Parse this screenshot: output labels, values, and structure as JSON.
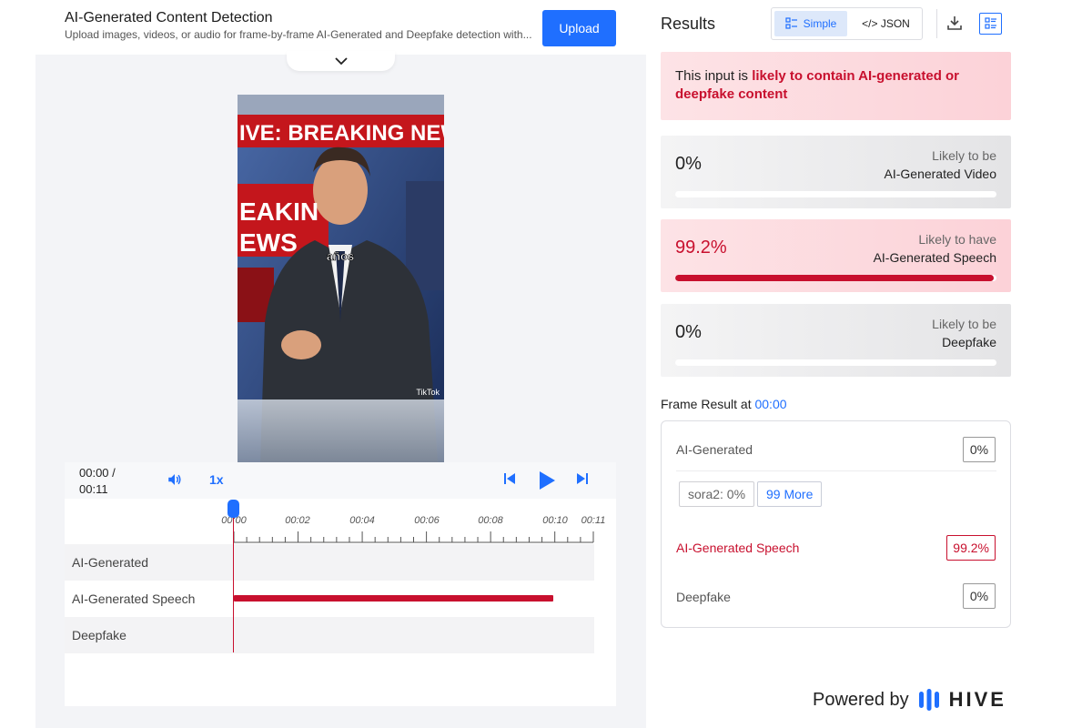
{
  "header": {
    "title": "AI-Generated Content Detection",
    "subtitle": "Upload images, videos, or audio for frame-by-frame AI-Generated and Deepfake detection with...",
    "upload_label": "Upload"
  },
  "video": {
    "banner_text": "IVE: BREAKING NEW",
    "side_text_1": "EAKIN",
    "side_text_2": "EWS",
    "caption": "años",
    "watermark": "TikTok"
  },
  "player": {
    "time_current": "00:00 /",
    "time_total": "00:11",
    "speed": "1x",
    "timeline_labels": [
      "00:00",
      "00:02",
      "00:04",
      "00:06",
      "00:08",
      "00:10",
      "00:11"
    ],
    "tracks": [
      "AI-Generated",
      "AI-Generated Speech",
      "Deepfake"
    ]
  },
  "results": {
    "title": "Results",
    "view_simple": "Simple",
    "view_json": "</> JSON",
    "verdict_prefix": "This input is ",
    "verdict_highlight": "likely to contain AI-generated or deepfake content",
    "cards": [
      {
        "pct": "0%",
        "line1": "Likely to be",
        "line2": "AI-Generated Video",
        "fill": 0
      },
      {
        "pct": "99.2%",
        "line1": "Likely to have",
        "line2": "AI-Generated Speech",
        "fill": 0.992
      },
      {
        "pct": "0%",
        "line1": "Likely to be",
        "line2": "Deepfake",
        "fill": 0
      }
    ]
  },
  "frame": {
    "label": "Frame Result at ",
    "time": "00:00",
    "rows": {
      "ai_label": "AI-Generated",
      "ai_value": "0%",
      "chip_model": "sora2: 0%",
      "chip_more": "99 More",
      "speech_label": "AI-Generated Speech",
      "speech_value": "99.2%",
      "deepfake_label": "Deepfake",
      "deepfake_value": "0%"
    }
  },
  "footer": {
    "powered_by": "Powered by",
    "brand": "HIVE"
  },
  "colors": {
    "accent": "#1f6fff",
    "alert": "#c8102e"
  },
  "icons": {
    "collapse": "chevron-down-icon",
    "volume": "volume-icon",
    "prev": "skip-back-icon",
    "play": "play-icon",
    "next": "skip-forward-icon",
    "simple": "list-view-icon",
    "download": "download-icon",
    "layout": "layout-icon",
    "logo": "hive-logo-icon"
  }
}
